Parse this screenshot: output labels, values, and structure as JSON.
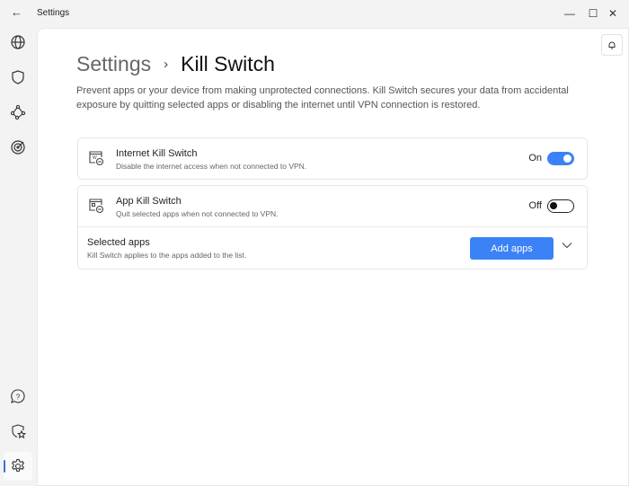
{
  "titlebar": {
    "title": "Settings",
    "back_icon": "arrow-left-icon",
    "minimize": "—",
    "maximize": "☐",
    "close": "✕"
  },
  "sidebar": {
    "items": [
      "globe-icon",
      "shield-icon",
      "nodes-icon",
      "target-icon"
    ],
    "bottom": [
      "help-icon",
      "shield-star-icon",
      "gear-icon"
    ]
  },
  "header": {
    "breadcrumb_parent": "Settings",
    "separator": "›",
    "breadcrumb_current": "Kill Switch",
    "description": "Prevent apps or your device from making unprotected connections. Kill Switch secures your data from accidental exposure by quitting selected apps or disabling the internet until VPN connection is restored."
  },
  "internet_kill_switch": {
    "title": "Internet Kill Switch",
    "subtitle": "Disable the internet access when not connected to VPN.",
    "state": "On",
    "enabled": true
  },
  "app_kill_switch": {
    "title": "App Kill Switch",
    "subtitle": "Quit selected apps when not connected to VPN.",
    "state": "Off",
    "enabled": false
  },
  "selected_apps": {
    "title": "Selected apps",
    "subtitle": "Kill Switch applies to the apps added to the list.",
    "button": "Add apps",
    "chevron": "⌄"
  },
  "colors": {
    "accent": "#3b82f6"
  }
}
